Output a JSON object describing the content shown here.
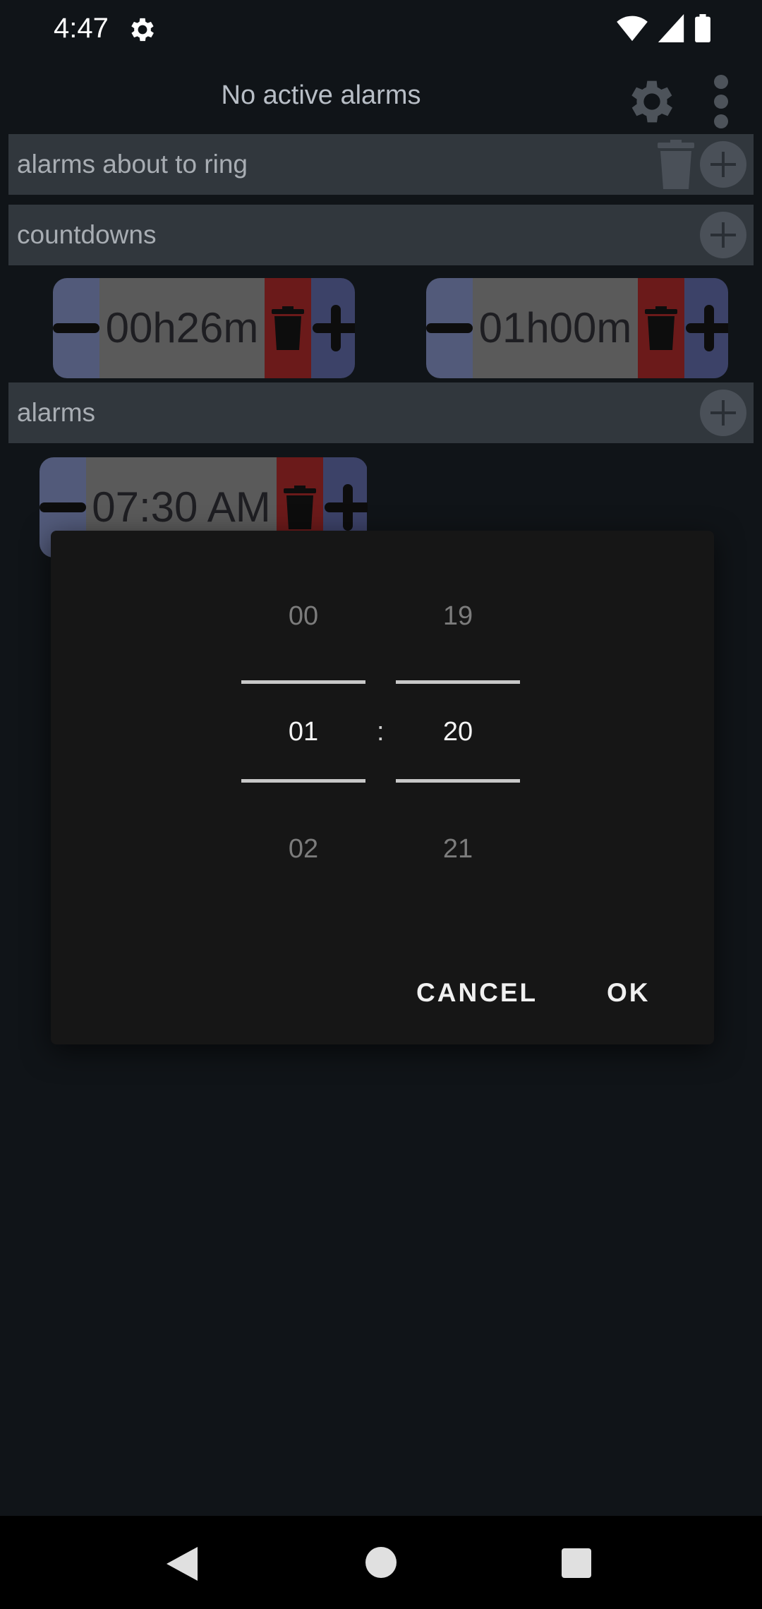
{
  "status_bar": {
    "time": "4:47"
  },
  "app_bar": {
    "title": "No active alarms"
  },
  "sections": {
    "about_to_ring": {
      "label": "alarms about to ring"
    },
    "countdowns": {
      "label": "countdowns"
    },
    "alarms": {
      "label": "alarms"
    }
  },
  "countdowns": [
    {
      "time": "00h26m"
    },
    {
      "time": "01h00m"
    }
  ],
  "alarms": [
    {
      "time": "07:30 AM"
    }
  ],
  "time_picker": {
    "hours": {
      "prev": "00",
      "selected": "01",
      "next": "02"
    },
    "minutes": {
      "prev": "19",
      "selected": "20",
      "next": "21"
    },
    "separator": ":"
  },
  "dialog_buttons": {
    "cancel": "CANCEL",
    "ok": "OK"
  },
  "colors": {
    "background": "#101418",
    "section_bar": "#31373d",
    "chip_minus": "#525a7a",
    "chip_time": "#5a5a5a",
    "chip_trash": "#6b1a1a",
    "chip_plus": "#3c4268",
    "dialog": "#161616"
  }
}
